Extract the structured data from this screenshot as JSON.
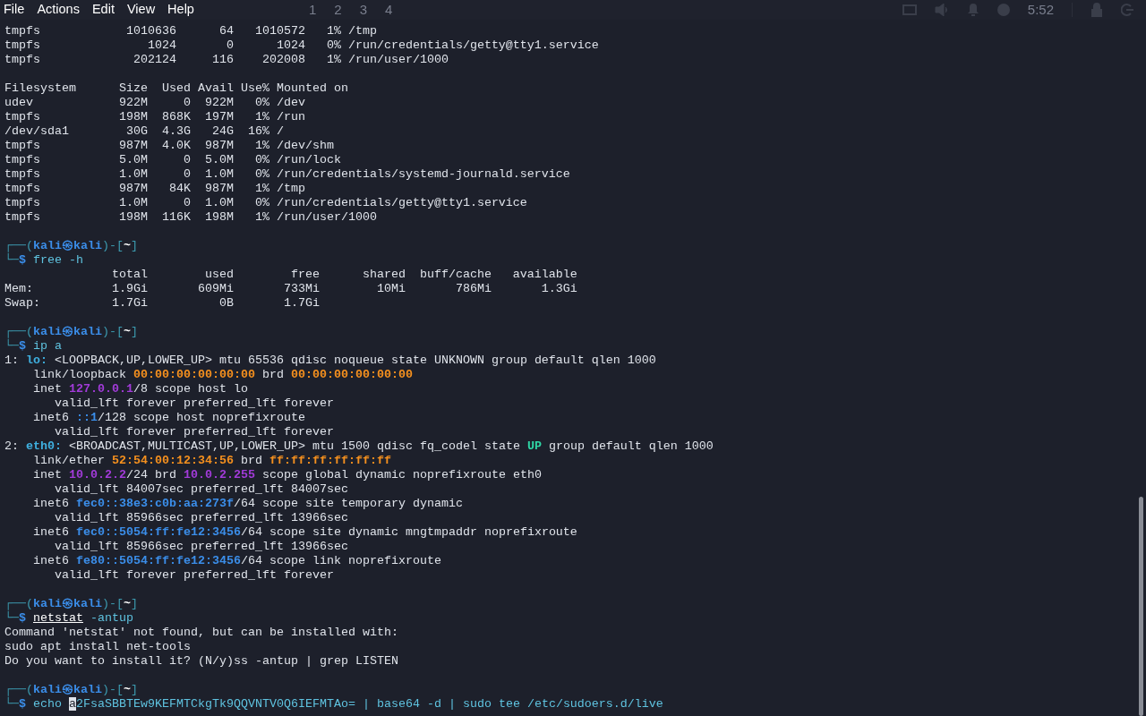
{
  "menu": [
    "File",
    "Actions",
    "Edit",
    "View",
    "Help"
  ],
  "workspaces": [
    "1",
    "2",
    "3",
    "4"
  ],
  "clock": "5:52",
  "blocks": [
    {
      "lines": [
        {
          "segments": [
            {
              "text": "tmpfs            1010636      64   1010572   1% /tmp",
              "kind": "plain"
            }
          ]
        },
        {
          "segments": [
            {
              "text": "tmpfs               1024       0      1024   0% /run/credentials/getty@tty1.service",
              "kind": "plain"
            }
          ]
        },
        {
          "segments": [
            {
              "text": "tmpfs             202124     116    202008   1% /run/user/1000",
              "kind": "plain"
            }
          ]
        }
      ]
    },
    {
      "lines": [
        {
          "segments": [
            {
              "text": "Filesystem      Size  Used Avail Use% Mounted on",
              "kind": "plain"
            }
          ]
        },
        {
          "segments": [
            {
              "text": "udev            922M     0  922M   0% /dev",
              "kind": "plain"
            }
          ]
        },
        {
          "segments": [
            {
              "text": "tmpfs           198M  868K  197M   1% /run",
              "kind": "plain"
            }
          ]
        },
        {
          "segments": [
            {
              "text": "/dev/sda1        30G  4.3G   24G  16% /",
              "kind": "plain"
            }
          ]
        },
        {
          "segments": [
            {
              "text": "tmpfs           987M  4.0K  987M   1% /dev/shm",
              "kind": "plain"
            }
          ]
        },
        {
          "segments": [
            {
              "text": "tmpfs           5.0M     0  5.0M   0% /run/lock",
              "kind": "plain"
            }
          ]
        },
        {
          "segments": [
            {
              "text": "tmpfs           1.0M     0  1.0M   0% /run/credentials/systemd-journald.service",
              "kind": "plain"
            }
          ]
        },
        {
          "segments": [
            {
              "text": "tmpfs           987M   84K  987M   1% /tmp",
              "kind": "plain"
            }
          ]
        },
        {
          "segments": [
            {
              "text": "tmpfs           1.0M     0  1.0M   0% /run/credentials/getty@tty1.service",
              "kind": "plain"
            }
          ]
        },
        {
          "segments": [
            {
              "text": "tmpfs           198M  116K  198M   1% /run/user/1000",
              "kind": "plain"
            }
          ]
        }
      ]
    },
    {
      "lines": [
        {
          "segments": [
            {
              "text": "┌──(",
              "kind": "frame"
            },
            {
              "text": "kali㉿kali",
              "kind": "user"
            },
            {
              "text": ")-[",
              "kind": "frame"
            },
            {
              "text": "~",
              "kind": "dir"
            },
            {
              "text": "]",
              "kind": "frame"
            }
          ]
        },
        {
          "segments": [
            {
              "text": "└─",
              "kind": "frame"
            },
            {
              "text": "$",
              "kind": "user"
            },
            {
              "text": " free -h",
              "kind": "cmd"
            }
          ]
        },
        {
          "segments": [
            {
              "text": "               total        used        free      shared  buff/cache   available",
              "kind": "plain"
            }
          ]
        },
        {
          "segments": [
            {
              "text": "Mem:           1.9Gi       609Mi       733Mi        10Mi       786Mi       1.3Gi",
              "kind": "plain"
            }
          ]
        },
        {
          "segments": [
            {
              "text": "Swap:          1.7Gi          0B       1.7Gi",
              "kind": "plain"
            }
          ]
        }
      ]
    },
    {
      "lines": [
        {
          "segments": [
            {
              "text": "┌──(",
              "kind": "frame"
            },
            {
              "text": "kali㉿kali",
              "kind": "user"
            },
            {
              "text": ")-[",
              "kind": "frame"
            },
            {
              "text": "~",
              "kind": "dir"
            },
            {
              "text": "]",
              "kind": "frame"
            }
          ]
        },
        {
          "segments": [
            {
              "text": "└─",
              "kind": "frame"
            },
            {
              "text": "$",
              "kind": "user"
            },
            {
              "text": " ip a",
              "kind": "cmd"
            }
          ]
        },
        {
          "segments": [
            {
              "text": "1: ",
              "kind": "plain"
            },
            {
              "text": "lo:",
              "kind": "iface"
            },
            {
              "text": " <LOOPBACK,UP,LOWER_UP> mtu 65536 qdisc noqueue state UNKNOWN group default qlen 1000",
              "kind": "plain"
            }
          ]
        },
        {
          "segments": [
            {
              "text": "    link/loopback ",
              "kind": "plain"
            },
            {
              "text": "00:00:00:00:00:00",
              "kind": "mac"
            },
            {
              "text": " brd ",
              "kind": "plain"
            },
            {
              "text": "00:00:00:00:00:00",
              "kind": "mac"
            }
          ]
        },
        {
          "segments": [
            {
              "text": "    inet ",
              "kind": "plain"
            },
            {
              "text": "127.0.0.1",
              "kind": "ipv4"
            },
            {
              "text": "/8 scope host lo",
              "kind": "plain"
            }
          ]
        },
        {
          "segments": [
            {
              "text": "       valid_lft forever preferred_lft forever",
              "kind": "plain"
            }
          ]
        },
        {
          "segments": [
            {
              "text": "    inet6 ",
              "kind": "plain"
            },
            {
              "text": "::1",
              "kind": "ipv6"
            },
            {
              "text": "/128 scope host noprefixroute",
              "kind": "plain"
            }
          ]
        },
        {
          "segments": [
            {
              "text": "       valid_lft forever preferred_lft forever",
              "kind": "plain"
            }
          ]
        },
        {
          "segments": [
            {
              "text": "2: ",
              "kind": "plain"
            },
            {
              "text": "eth0:",
              "kind": "iface"
            },
            {
              "text": " <BROADCAST,MULTICAST,UP,LOWER_UP> mtu 1500 qdisc fq_codel state ",
              "kind": "plain"
            },
            {
              "text": "UP",
              "kind": "up"
            },
            {
              "text": " group default qlen 1000",
              "kind": "plain"
            }
          ]
        },
        {
          "segments": [
            {
              "text": "    link/ether ",
              "kind": "plain"
            },
            {
              "text": "52:54:00:12:34:56",
              "kind": "mac"
            },
            {
              "text": " brd ",
              "kind": "plain"
            },
            {
              "text": "ff:ff:ff:ff:ff:ff",
              "kind": "mac"
            }
          ]
        },
        {
          "segments": [
            {
              "text": "    inet ",
              "kind": "plain"
            },
            {
              "text": "10.0.2.2",
              "kind": "ipv4"
            },
            {
              "text": "/24 brd ",
              "kind": "plain"
            },
            {
              "text": "10.0.2.255",
              "kind": "ipv4"
            },
            {
              "text": " scope global dynamic noprefixroute eth0",
              "kind": "plain"
            }
          ]
        },
        {
          "segments": [
            {
              "text": "       valid_lft 84007sec preferred_lft 84007sec",
              "kind": "plain"
            }
          ]
        },
        {
          "segments": [
            {
              "text": "    inet6 ",
              "kind": "plain"
            },
            {
              "text": "fec0::38e3:c0b:aa:273f",
              "kind": "ipv6"
            },
            {
              "text": "/64 scope site temporary dynamic",
              "kind": "plain"
            }
          ]
        },
        {
          "segments": [
            {
              "text": "       valid_lft 85966sec preferred_lft 13966sec",
              "kind": "plain"
            }
          ]
        },
        {
          "segments": [
            {
              "text": "    inet6 ",
              "kind": "plain"
            },
            {
              "text": "fec0::5054:ff:fe12:3456",
              "kind": "ipv6"
            },
            {
              "text": "/64 scope site dynamic mngtmpaddr noprefixroute",
              "kind": "plain"
            }
          ]
        },
        {
          "segments": [
            {
              "text": "       valid_lft 85966sec preferred_lft 13966sec",
              "kind": "plain"
            }
          ]
        },
        {
          "segments": [
            {
              "text": "    inet6 ",
              "kind": "plain"
            },
            {
              "text": "fe80::5054:ff:fe12:3456",
              "kind": "ipv6"
            },
            {
              "text": "/64 scope link noprefixroute",
              "kind": "plain"
            }
          ]
        },
        {
          "segments": [
            {
              "text": "       valid_lft forever preferred_lft forever",
              "kind": "plain"
            }
          ]
        }
      ]
    },
    {
      "lines": [
        {
          "segments": [
            {
              "text": "┌──(",
              "kind": "frame"
            },
            {
              "text": "kali㉿kali",
              "kind": "user"
            },
            {
              "text": ")-[",
              "kind": "frame"
            },
            {
              "text": "~",
              "kind": "dir"
            },
            {
              "text": "]",
              "kind": "frame"
            }
          ]
        },
        {
          "segments": [
            {
              "text": "└─",
              "kind": "frame"
            },
            {
              "text": "$ ",
              "kind": "user"
            },
            {
              "text": "netstat",
              "kind": "unknown-cmd"
            },
            {
              "text": " -antup",
              "kind": "cmd"
            }
          ]
        },
        {
          "segments": [
            {
              "text": "Command 'netstat' not found, but can be installed with:",
              "kind": "plain"
            }
          ]
        },
        {
          "segments": [
            {
              "text": "sudo apt install net-tools",
              "kind": "plain"
            }
          ]
        },
        {
          "segments": [
            {
              "text": "Do you want to install it? (N/y)ss -antup | grep LISTEN",
              "kind": "plain"
            }
          ]
        }
      ]
    },
    {
      "lines": [
        {
          "segments": [
            {
              "text": "┌──(",
              "kind": "frame"
            },
            {
              "text": "kali㉿kali",
              "kind": "user"
            },
            {
              "text": ")-[",
              "kind": "frame"
            },
            {
              "text": "~",
              "kind": "dir"
            },
            {
              "text": "]",
              "kind": "frame"
            }
          ]
        },
        {
          "segments": [
            {
              "text": "└─",
              "kind": "frame"
            },
            {
              "text": "$",
              "kind": "user"
            },
            {
              "text": " echo ",
              "kind": "cmd"
            },
            {
              "text": "a",
              "kind": "cursor"
            },
            {
              "text": "2FsaSBBTEw9KEFMTCkgTk9QQVNTV0Q6IEFMTAo= | base64 -d | sudo tee /etc/sudoers.d/live",
              "kind": "cmd"
            }
          ]
        }
      ]
    }
  ]
}
